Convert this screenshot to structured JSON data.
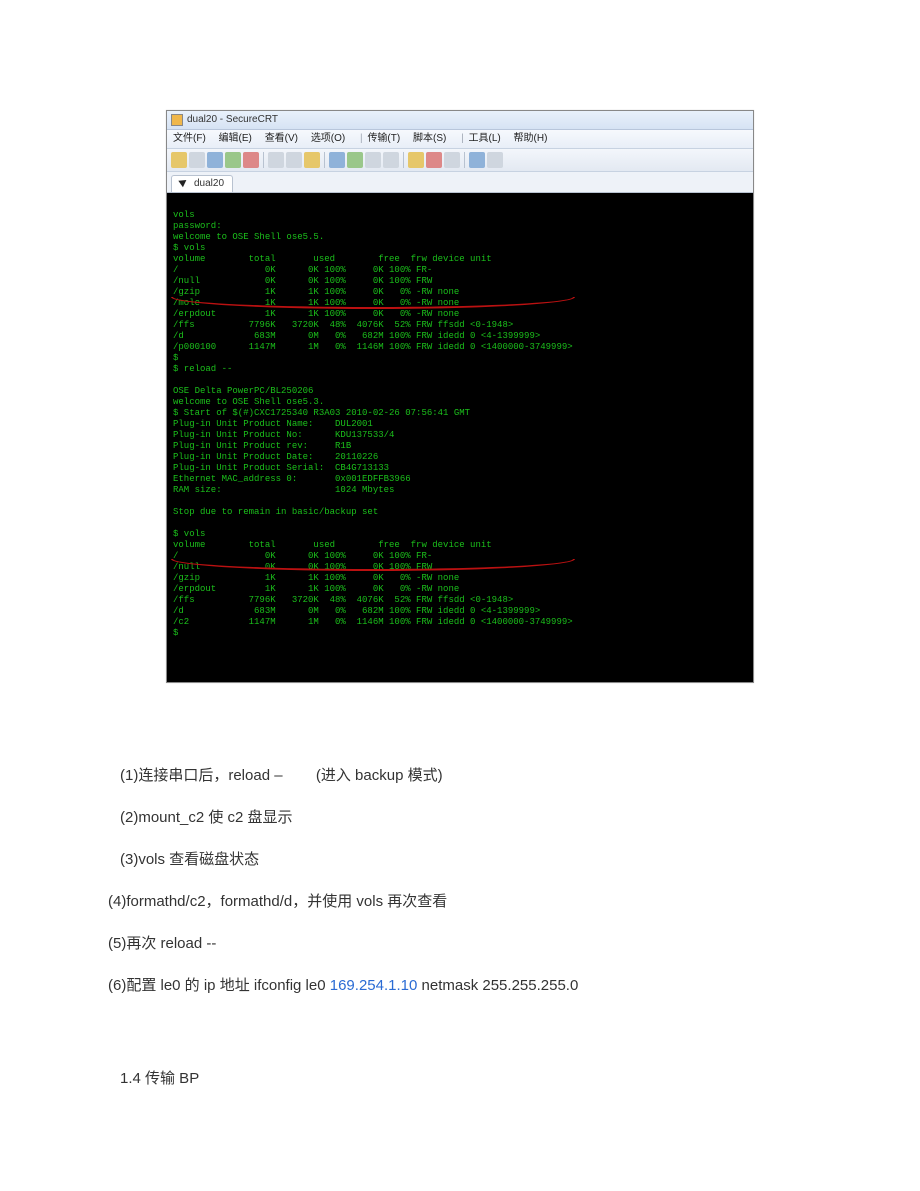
{
  "app": {
    "title": "dual20 - SecureCRT",
    "menus": [
      "文件(F)",
      "编辑(E)",
      "查看(V)",
      "选项(O)",
      "传输(T)",
      "脚本(S)",
      "工具(L)",
      "帮助(H)"
    ],
    "tab": "dual20"
  },
  "terminal": {
    "block1": "vols\npassword:\nwelcome to OSE Shell ose5.5.\n$ vols\nvolume        total       used        free  frw device unit\n/                0K      0K 100%     0K 100% FR-\n/null            0K      0K 100%     0K 100% FRW\n/gzip            1K      1K 100%     0K   0% -RW none\n/mole            1K      1K 100%     0K   0% -RW none\n/erpdout         1K      1K 100%     0K   0% -RW none\n/ffs          7796K   3720K  48%  4076K  52% FRW ffsdd <0-1948>\n/d             683M      0M   0%   682M 100% FRW idedd 0 <4-1399999>\n/p000100      1147M      1M   0%  1146M 100% FRW idedd 0 <1400000-3749999>\n$\n$ reload --",
    "block2": "OSE Delta PowerPC/BL250206\nwelcome to OSE Shell ose5.3.\n$ Start of $(#)CXC1725340 R3A03 2010-02-26 07:56:41 GMT\nPlug-in Unit Product Name:    DUL2001\nPlug-in Unit Product No:      KDU137533/4\nPlug-in Unit Product rev:     R1B\nPlug-in Unit Product Date:    20110226\nPlug-in Unit Product Serial:  CB4G713133\nEthernet MAC_address 0:       0x001EDFFB3966\nRAM size:                     1024 Mbytes\n\nStop due to remain in basic/backup set",
    "block3": "$ vols\nvolume        total       used        free  frw device unit\n/                0K      0K 100%     0K 100% FR-\n/null            0K      0K 100%     0K 100% FRW\n/gzip            1K      1K 100%     0K   0% -RW none\n/erpdout         1K      1K 100%     0K   0% -RW none\n/ffs          7796K   3720K  48%  4076K  52% FRW ffsdd <0-1948>\n/d             683M      0M   0%   682M 100% FRW idedd 0 <4-1399999>\n/c2           1147M      1M   0%  1146M 100% FRW idedd 0 <1400000-3749999>\n$"
  },
  "steps": {
    "s1a": "(1)连接串口后，reload –",
    "s1b": "(进入 backup 模式)",
    "s2": "(2)mount_c2 使 c2 盘显示",
    "s3": "(3)vols 查看磁盘状态",
    "s4": "(4)formathd/c2，formathd/d，并使用 vols 再次查看",
    "s5": "(5)再次 reload --",
    "s6a": "(6)配置 le0 的 ip 地址 ifconfig le0 ",
    "s6ip": "169.254.1.10",
    "s6b": " netmask 255.255.255.0"
  },
  "section": "1.4 传输 BP"
}
